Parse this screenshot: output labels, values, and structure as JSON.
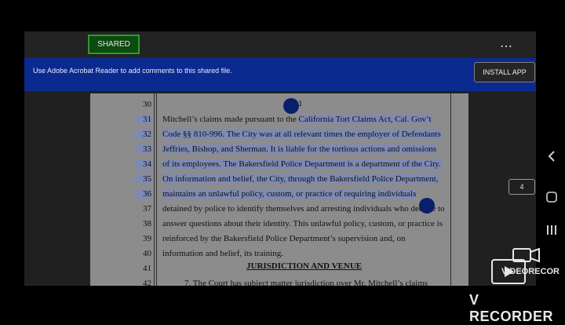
{
  "topbar": {
    "shared_label": "SHARED",
    "more_icon": "⋯"
  },
  "banner": {
    "message": "Use Adobe Acrobat Reader to add comments to this shared file.",
    "install_label": "INSTALL APP"
  },
  "document": {
    "page_number_indicator": "4",
    "footer_page_digit": "1",
    "section_heading": "JURISDICTION AND VENUE",
    "lines": [
      {
        "n": "30",
        "text": "",
        "selected": false
      },
      {
        "n": "31",
        "pre": "Mitchell’s claims made pursuant to the ",
        "sel": "California Tort Claims Act, Cal. Gov’t",
        "selected": true
      },
      {
        "n": "32",
        "sel": "Code §§ 810-996.  The City was at all relevant times the employer of Defendants",
        "selected": true
      },
      {
        "n": "33",
        "sel": "Jeffries, Bishop, and Sherman.  It is liable for the tortious actions and omissions",
        "selected": true
      },
      {
        "n": "34",
        "sel": "of its employees.  The Bakersfield Police Department is a department of the City.",
        "selected": true
      },
      {
        "n": "35",
        "sel": "On information and belief, the City, through the Bakersfield Police Department,",
        "selected": true
      },
      {
        "n": "36",
        "sel": "maintains an unlawful policy, custom, or practice of requiring individuals",
        "selected": true
      },
      {
        "n": "37",
        "text": "detained by police to identify themselves and arresting individuals who decline to",
        "selected": false
      },
      {
        "n": "38",
        "text": "answer questions about their identity. This unlawful policy, custom, or practice is",
        "selected": false
      },
      {
        "n": "39",
        "text": "reinforced by the Bakersfield Police Department’s supervision and, on",
        "selected": false
      },
      {
        "n": "40",
        "text": "information and belief, its training.",
        "selected": false
      },
      {
        "n": "41",
        "text": "",
        "selected": false
      },
      {
        "n": "42",
        "text": "7.          The Court has subject matter jurisdiction over Mr. Mitchell’s claims",
        "selected": false
      }
    ]
  },
  "recorder": {
    "logo_text": "VIDEORECORDER",
    "watermark": "V RECORDER"
  },
  "system_nav": {
    "buttons": [
      "back-icon",
      "home-icon",
      "recents-icon"
    ]
  }
}
